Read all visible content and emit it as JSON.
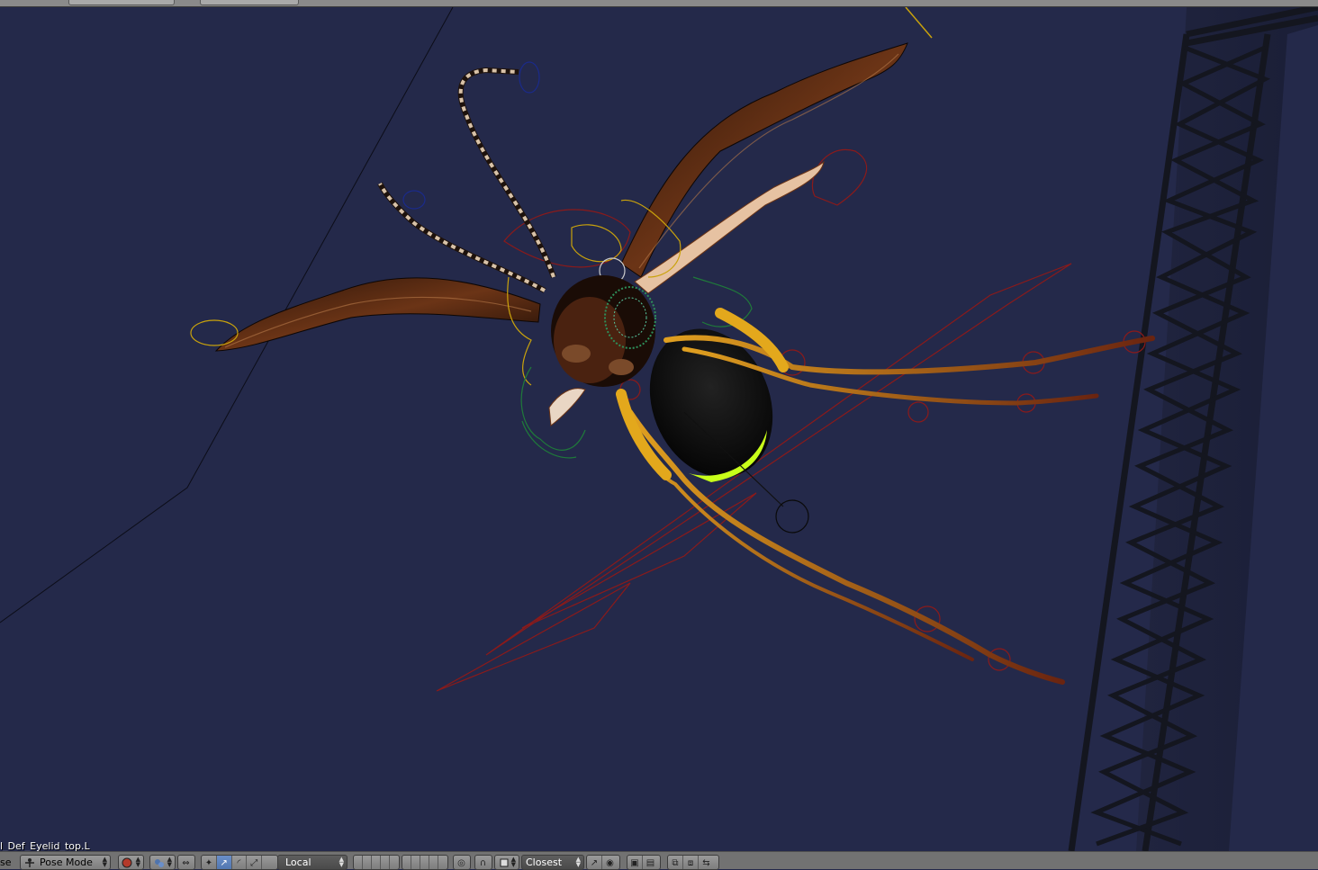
{
  "viewport": {
    "background_color": "#24294a",
    "active_bone_label": "l_Def_Eyelid_top.L"
  },
  "header": {
    "left_cut_text": "se",
    "mode_selector": {
      "value": "Pose Mode",
      "icon": "armature-pose-icon"
    },
    "viewport_shading_icon": "shading-sphere-icon",
    "pivot_icon": "pivot-point-icon",
    "manipulator_icons": [
      "manipulator-toggle-icon",
      "translate-icon",
      "rotate-icon",
      "scale-icon"
    ],
    "orientation_selector": {
      "value": "Local"
    },
    "layer_buttons_count": 20,
    "proportional_icon": "proportional-edit-icon",
    "snap_icon": "snap-icon",
    "snap_element_icon": "snap-element-icon",
    "snap_target_selector": {
      "value": "Closest"
    },
    "snap_extra_icons": [
      "snap-align-icon",
      "snap-project-icon"
    ],
    "render_icons": [
      "render-icon",
      "clapper-icon"
    ],
    "pose_copy_icons": [
      "copy-pose-icon",
      "paste-pose-icon",
      "paste-flipped-icon"
    ]
  },
  "colors": {
    "header_bg": "#727272",
    "bone_selected": "#8b1a1a",
    "bone_yellow": "#c9a20c",
    "bone_green": "#1f7a3a",
    "bone_blue": "#1a2a8b"
  }
}
